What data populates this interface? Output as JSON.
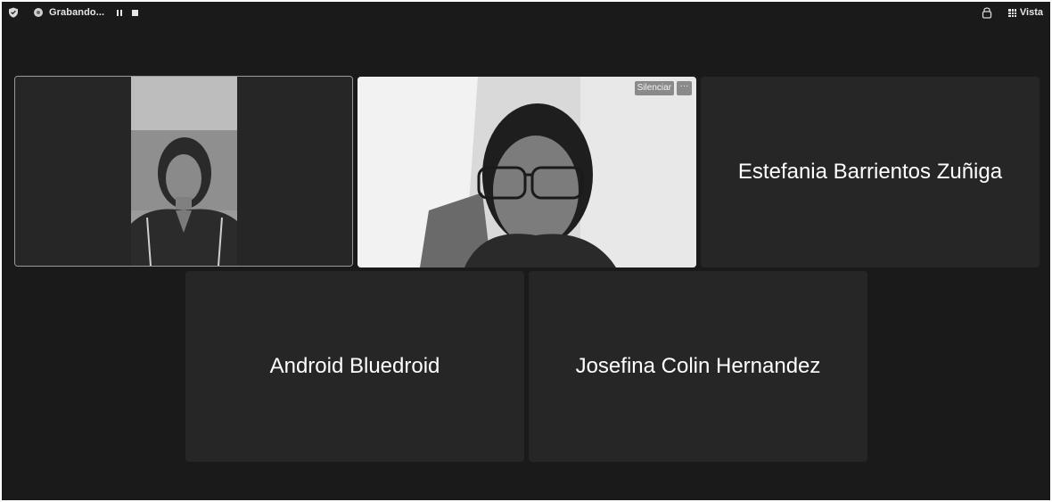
{
  "topbar": {
    "recording_label": "Grabando...",
    "view_label": "Vista"
  },
  "tiles": [
    {
      "id": "participant-1",
      "type": "video",
      "name": ""
    },
    {
      "id": "participant-2",
      "type": "video",
      "name": "",
      "mute_label": "Silenciar",
      "more_label": "···"
    },
    {
      "id": "participant-3",
      "type": "name",
      "name": "Estefania Barrientos Zuñiga"
    },
    {
      "id": "participant-4",
      "type": "name",
      "name": "Android Bluedroid"
    },
    {
      "id": "participant-5",
      "type": "name",
      "name": "Josefina Colin Hernandez"
    }
  ],
  "colors": {
    "background": "#1a1a1a",
    "tile": "#262626",
    "active_border": "#9a9a9a"
  }
}
